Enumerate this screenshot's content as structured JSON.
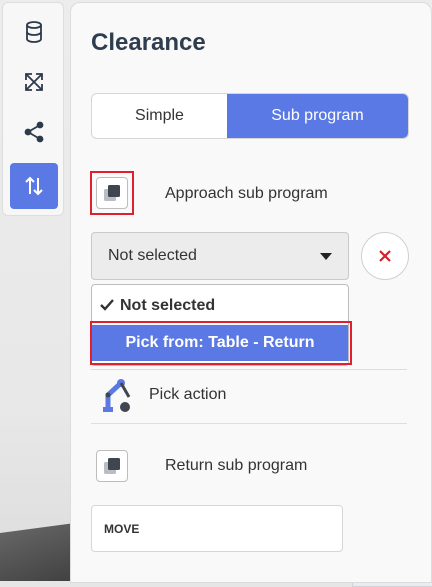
{
  "toolbar": {
    "items": [
      {
        "icon": "database-icon"
      },
      {
        "icon": "expand-arrows-icon"
      },
      {
        "icon": "share-nodes-icon"
      },
      {
        "icon": "sort-arrows-icon",
        "active": true
      }
    ]
  },
  "panel": {
    "title": "Clearance",
    "tabs": [
      {
        "label": "Simple",
        "active": false
      },
      {
        "label": "Sub program",
        "active": true
      }
    ],
    "approach": {
      "label": "Approach sub program",
      "selected": "Not selected",
      "options": [
        "Not selected",
        "Pick from: Table - Return"
      ]
    },
    "pick_action": {
      "label": "Pick action"
    },
    "return": {
      "label": "Return sub program"
    },
    "move": {
      "label": "MOVE"
    }
  },
  "colors": {
    "accent": "#5b79e4",
    "highlight": "#e0202e",
    "danger": "#d6202a"
  }
}
